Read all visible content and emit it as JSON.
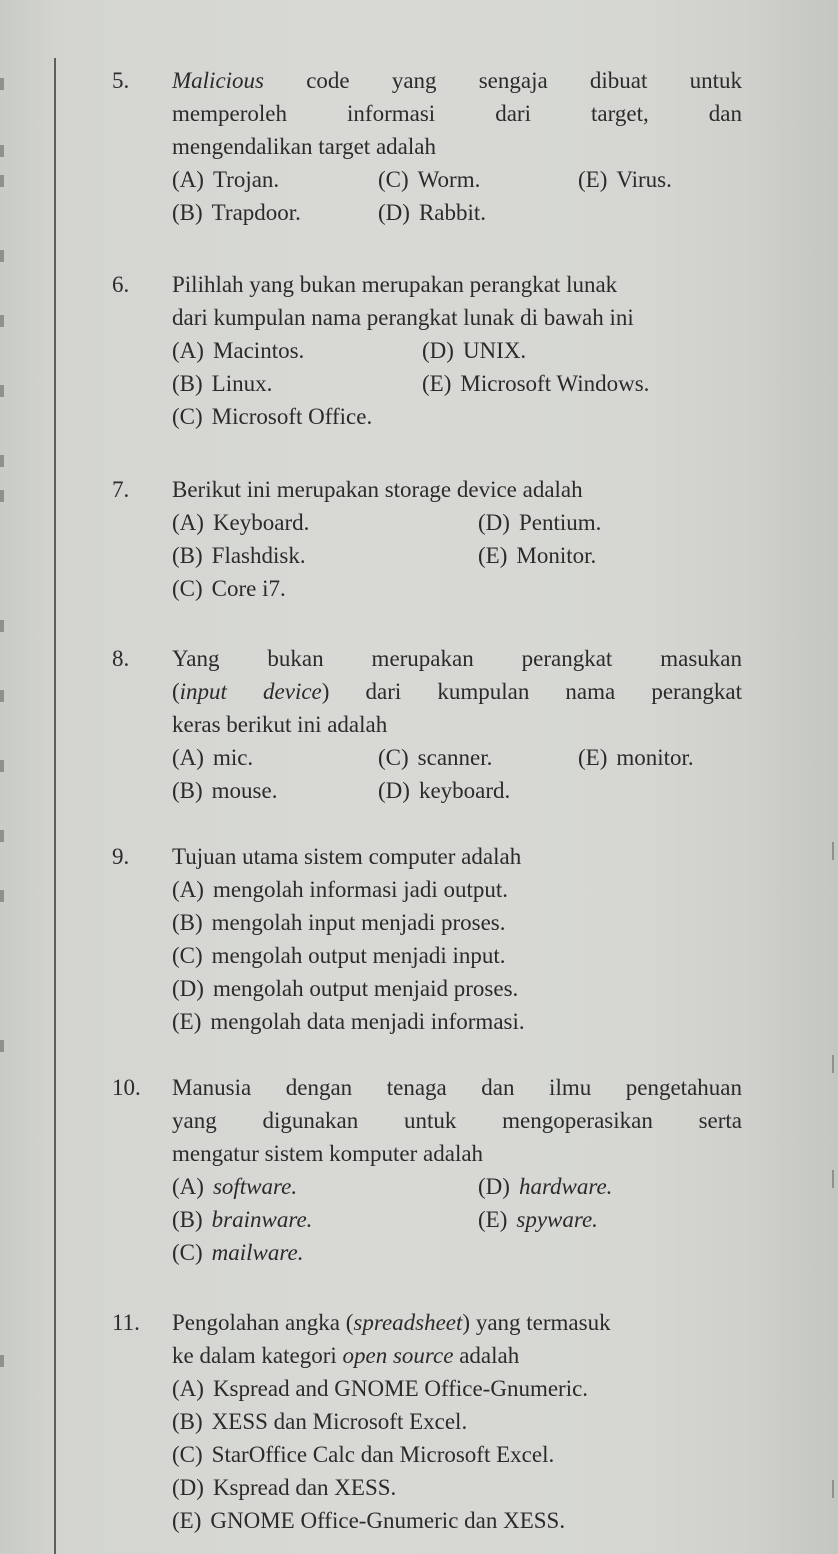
{
  "page": {
    "background_color": "#d6d7d2",
    "text_color": "#2b2b2b",
    "rule_color": "#5f605d"
  },
  "questions": [
    {
      "number": "5.",
      "stem_lines": [
        {
          "parts": [
            {
              "text": "Malicious",
              "italic": true
            },
            {
              "text": " code yang sengaja dibuat untuk"
            }
          ]
        },
        {
          "parts": [
            {
              "text": "memperoleh informasi dari target, dan"
            }
          ]
        },
        {
          "parts": [
            {
              "text": "mengendalikan target adalah"
            }
          ]
        }
      ],
      "options": [
        {
          "letter": "(A)",
          "text": "Trojan."
        },
        {
          "letter": "(B)",
          "text": "Trapdoor."
        },
        {
          "letter": "(C)",
          "text": "Worm."
        },
        {
          "letter": "(D)",
          "text": "Rabbit."
        },
        {
          "letter": "(E)",
          "text": "Virus."
        }
      ]
    },
    {
      "number": "6.",
      "stem_lines": [
        {
          "parts": [
            {
              "text": "Pilihlah yang bukan merupakan perangkat lunak"
            }
          ]
        },
        {
          "parts": [
            {
              "text": "dari kumpulan nama perangkat lunak di bawah ini"
            }
          ]
        }
      ],
      "options": [
        {
          "letter": "(A)",
          "text": "Macintos."
        },
        {
          "letter": "(B)",
          "text": "Linux."
        },
        {
          "letter": "(C)",
          "text": "Microsoft Office."
        },
        {
          "letter": "(D)",
          "text": "UNIX."
        },
        {
          "letter": "(E)",
          "text": "Microsoft Windows."
        }
      ]
    },
    {
      "number": "7.",
      "stem_lines": [
        {
          "parts": [
            {
              "text": "Berikut ini merupakan storage device adalah"
            }
          ]
        }
      ],
      "options": [
        {
          "letter": "(A)",
          "text": "Keyboard."
        },
        {
          "letter": "(B)",
          "text": "Flashdisk."
        },
        {
          "letter": "(C)",
          "text": "Core i7."
        },
        {
          "letter": "(D)",
          "text": "Pentium."
        },
        {
          "letter": "(E)",
          "text": "Monitor."
        }
      ]
    },
    {
      "number": "8.",
      "stem_lines": [
        {
          "parts": [
            {
              "text": "Yang bukan merupakan perangkat masukan"
            }
          ]
        },
        {
          "parts": [
            {
              "text": "("
            },
            {
              "text": "input device",
              "italic": true
            },
            {
              "text": ") dari kumpulan nama perangkat"
            }
          ]
        },
        {
          "parts": [
            {
              "text": "keras berikut ini adalah"
            }
          ]
        }
      ],
      "options": [
        {
          "letter": "(A)",
          "text": "mic."
        },
        {
          "letter": "(B)",
          "text": "mouse."
        },
        {
          "letter": "(C)",
          "text": "scanner."
        },
        {
          "letter": "(D)",
          "text": "keyboard."
        },
        {
          "letter": "(E)",
          "text": "monitor."
        }
      ]
    },
    {
      "number": "9.",
      "stem_lines": [
        {
          "parts": [
            {
              "text": "Tujuan utama sistem computer adalah"
            }
          ]
        }
      ],
      "options": [
        {
          "letter": "(A)",
          "text": "mengolah informasi jadi output."
        },
        {
          "letter": "(B)",
          "text": "mengolah input menjadi proses."
        },
        {
          "letter": "(C)",
          "text": "mengolah output menjadi input."
        },
        {
          "letter": "(D)",
          "text": "mengolah output menjaid proses."
        },
        {
          "letter": "(E)",
          "text": "mengolah data menjadi informasi."
        }
      ]
    },
    {
      "number": "10.",
      "stem_lines": [
        {
          "parts": [
            {
              "text": "Manusia dengan tenaga dan ilmu pengetahuan"
            }
          ]
        },
        {
          "parts": [
            {
              "text": "yang digunakan untuk mengoperasikan serta"
            }
          ]
        },
        {
          "parts": [
            {
              "text": "mengatur sistem komputer adalah"
            }
          ]
        }
      ],
      "options": [
        {
          "letter": "(A)",
          "text": "software.",
          "italic": true
        },
        {
          "letter": "(B)",
          "text": "brainware.",
          "italic": true
        },
        {
          "letter": "(C)",
          "text": "mailware.",
          "italic": true
        },
        {
          "letter": "(D)",
          "text": "hardware.",
          "italic": true
        },
        {
          "letter": "(E)",
          "text": "spyware.",
          "italic": true
        }
      ]
    },
    {
      "number": "11.",
      "stem_lines": [
        {
          "parts": [
            {
              "text": "Pengolahan angka ("
            },
            {
              "text": "spreadsheet",
              "italic": true
            },
            {
              "text": ") yang termasuk"
            }
          ]
        },
        {
          "parts": [
            {
              "text": "ke dalam kategori "
            },
            {
              "text": "open source",
              "italic": true
            },
            {
              "text": " adalah"
            }
          ]
        }
      ],
      "options": [
        {
          "letter": "(A)",
          "text": "Kspread and GNOME Office-Gnumeric."
        },
        {
          "letter": "(B)",
          "text": "XESS dan Microsoft Excel."
        },
        {
          "letter": "(C)",
          "text": "StarOffice Calc dan Microsoft Excel."
        },
        {
          "letter": "(D)",
          "text": "Kspread dan XESS."
        },
        {
          "letter": "(E)",
          "text": "GNOME Office-Gnumeric dan XESS."
        }
      ]
    }
  ]
}
